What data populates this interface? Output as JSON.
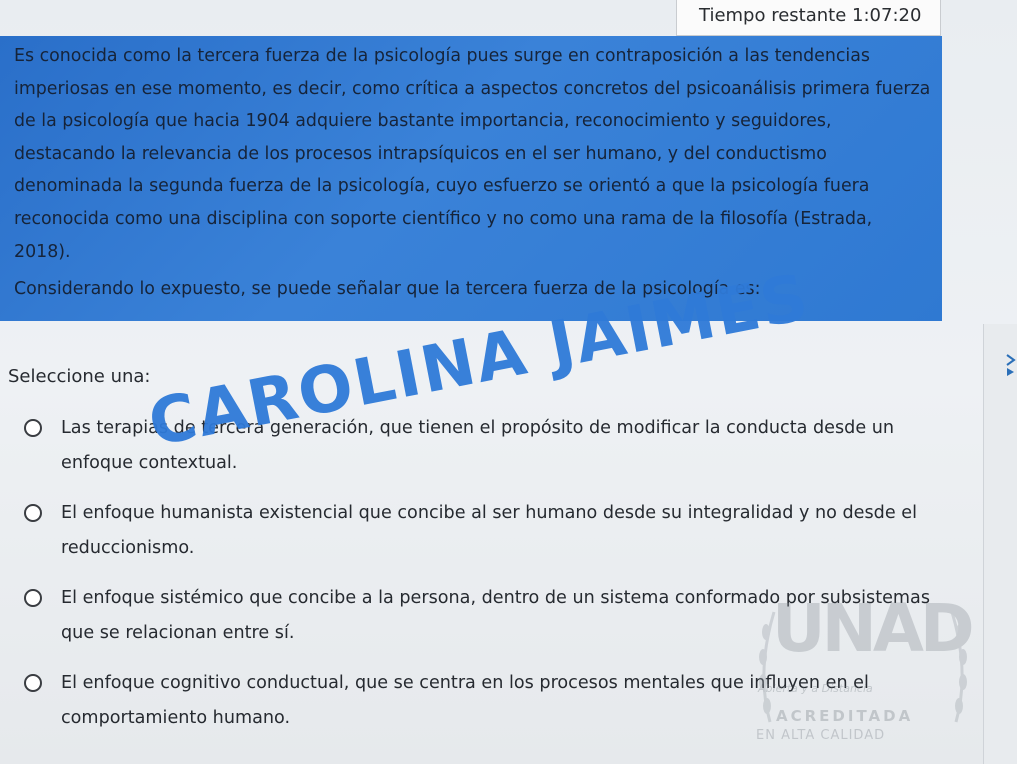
{
  "timer": {
    "label": "Tiempo restante",
    "value": "1:07:20"
  },
  "question": {
    "body": "Es conocida como la tercera fuerza de la psicología pues surge en contraposición a las tendencias imperiosas en ese momento, es decir, como crítica a aspectos concretos del psicoanálisis primera fuerza de la psicología que hacia 1904 adquiere bastante importancia, reconocimiento y seguidores, destacando la relevancia de los procesos intrapsíquicos en el ser humano, y del conductismo denominada la segunda fuerza de la psicología, cuyo esfuerzo se orientó a que la psicología fuera reconocida como una disciplina con soporte científico y no como una rama de la filosofía (Estrada, 2018).",
    "prompt": "Considerando lo expuesto, se puede señalar que la tercera fuerza de la psicología es:"
  },
  "answer": {
    "instruction": "Seleccione una:",
    "options": [
      {
        "label": "Las terapias de tercera generación, que tienen el propósito de modificar la conducta desde un enfoque contextual.",
        "selected": false
      },
      {
        "label": "El enfoque humanista existencial que concibe al ser humano desde su integralidad y no desde el reduccionismo.",
        "selected": false
      },
      {
        "label": "El enfoque sistémico que concibe a la persona, dentro de un sistema conformado por subsistemas que se relacionan entre sí.",
        "selected": false
      },
      {
        "label": "El enfoque cognitivo conductual, que se centra en los procesos mentales que influyen en el comportamiento humano.",
        "selected": false
      }
    ]
  },
  "watermark": {
    "text": "CAROLINA JAIMES"
  },
  "logo": {
    "letters": "UNAD",
    "line1": "Abierta y a Distancia",
    "line2": "ACREDITADA",
    "line3": "EN ALTA CALIDAD"
  },
  "side_panel": {
    "icon": "arrow-icon"
  },
  "colors": {
    "question_bg": "#2f79d2",
    "watermark": "#2f7ad8",
    "page_bg": "#eceff2"
  }
}
